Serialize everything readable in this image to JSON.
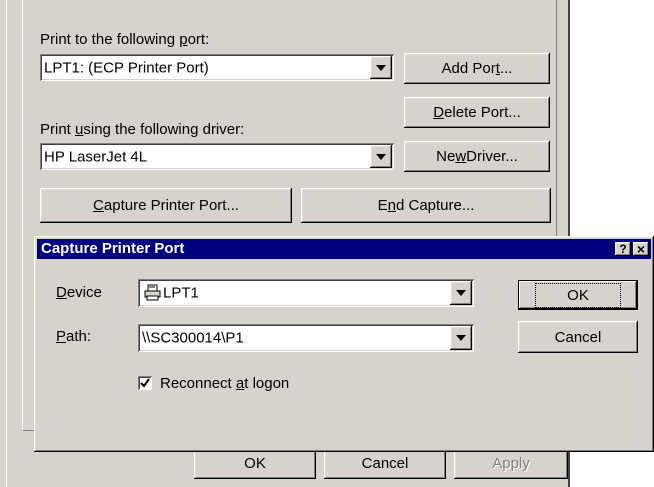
{
  "main": {
    "port_label_pre": "Print to the following ",
    "port_label_key": "p",
    "port_label_post": "ort:",
    "port_value": "LPT1:  (ECP Printer Port)",
    "add_port_pre": "Add Por",
    "add_port_key": "t",
    "add_port_post": "...",
    "delete_port_key": "D",
    "delete_port_post": "elete Port...",
    "driver_label_pre": "Print ",
    "driver_label_key": "u",
    "driver_label_post": "sing the following driver:",
    "driver_value": "HP LaserJet 4L",
    "new_driver_pre": "Ne",
    "new_driver_key": "w",
    "new_driver_post": " Driver...",
    "capture_key": "C",
    "capture_post": "apture Printer Port...",
    "end_capture_pre": "E",
    "end_capture_key": "n",
    "end_capture_post": "d Capture...",
    "ok_label": "OK",
    "cancel_label": "Cancel",
    "apply_label": "Apply"
  },
  "dialog": {
    "title": "Capture Printer Port",
    "help_glyph": "?",
    "close_glyph": "×",
    "device_key": "D",
    "device_post": "evice",
    "device_value": "LPT1",
    "path_key": "P",
    "path_post": "ath:",
    "path_value": "\\\\SC300014\\P1",
    "reconnect_pre": "Reconnect ",
    "reconnect_key": "a",
    "reconnect_post": "t logon",
    "reconnect_checked": true,
    "ok_label": "OK",
    "cancel_label": "Cancel",
    "title_bar_color": "#000080"
  }
}
